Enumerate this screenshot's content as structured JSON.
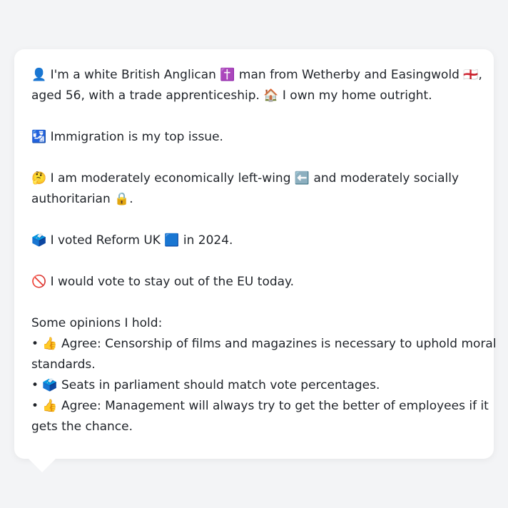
{
  "persona": {
    "intro": {
      "line1": "👤 I'm a white British Anglican ✝️ man from Wetherby and Easingwold 🏴󠁧󠁢󠁥󠁮󠁧󠁿,",
      "line2": "aged 56, with a trade apprenticeship. 🏠 I own my home outright."
    },
    "top_issue": "🛂 Immigration is my top issue.",
    "ideology": {
      "line1": "🤔 I am moderately economically left-wing ⬅️ and moderately socially",
      "line2": "authoritarian 🔒."
    },
    "vote_2024": "🗳️ I voted Reform UK 🟦 in 2024.",
    "eu_stance": "🚫 I would vote to stay out of the EU today.",
    "opinions": {
      "heading": "Some opinions I hold:",
      "items": [
        {
          "line1": "• 👍 Agree: Censorship of films and magazines is necessary to uphold moral",
          "line2": "standards."
        },
        {
          "line1": "• 🗳️ Seats in parliament should match vote percentages."
        },
        {
          "line1": "• 👍 Agree: Management will always try to get the better of employees if it",
          "line2": "gets the chance."
        }
      ]
    }
  }
}
